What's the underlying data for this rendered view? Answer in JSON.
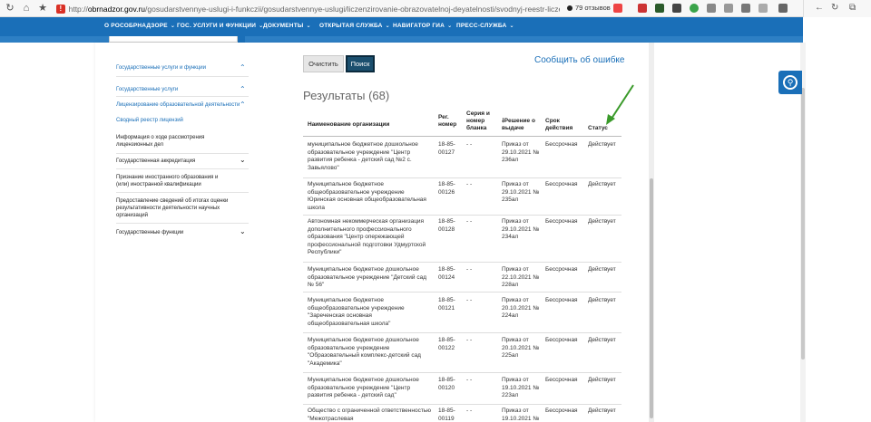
{
  "browser": {
    "url_host": "obrnadzor.gov.ru",
    "url_prefix": "http://",
    "url_path": "/gosudarstvennye-uslugi-i-funkczii/gosudarstvennye-uslugi/liczenzirovanie-obrazovatelnoj-deyatelnosti/svodnyj-reestr-liczenzij/",
    "reviews": "79 отзывов"
  },
  "topnav": {
    "items": [
      "О РОСОБРНАДЗОРЕ",
      "ГОС. УСЛУГИ И ФУНКЦИИ",
      "ДОКУМЕНТЫ",
      "ОТКРЫТАЯ СЛУЖБА",
      "НАВИГАТОР ГИА",
      "ПРЕСС-СЛУЖБА"
    ]
  },
  "sidebar": {
    "items": [
      "Государственные услуги и функции",
      "Государственные услуги",
      "Лицензирование образовательной деятельности",
      "Сводный реестр лицензий",
      "Информация о ходе рассмотрения лицензионных дел",
      "Государственная аккредитация",
      "Признание иностранного образования и (или) иностранной квалификации",
      "Предоставление сведений об итогах оценки результативности деятельности научных организаций",
      "Государственные функции"
    ]
  },
  "form": {
    "clear_label": "Очистить",
    "search_label": "Поиск",
    "report_label": "Сообщить об ошибке"
  },
  "results": {
    "title": "Результаты (68)",
    "headers": {
      "name": "Наименование организации",
      "reg": "Рег. номер",
      "series": "Серия и номер бланка",
      "decision": "Решение о выдаче",
      "term": "Срок действия",
      "status": "Статус"
    },
    "rows": [
      {
        "name": "муниципальное бюджетное дошкольное образовательное учреждение \"Центр развития ребенка - детский сад №2 с. Завьялово\"",
        "reg": "18-85-00127",
        "series": "- -",
        "decision": "Приказ от 29.10.2021 № 236ал",
        "term": "Бессрочная",
        "status": "Действует"
      },
      {
        "name": "Муниципальное бюджетное общеобразовательное учреждение Юринская основная общеобразовательная школа",
        "reg": "18-85-00126",
        "series": "- -",
        "decision": "Приказ от 29.10.2021 № 235ал",
        "term": "Бессрочная",
        "status": "Действует"
      },
      {
        "name": "Автономная некоммерческая организация дополнительного профессионального образования \"Центр опережающей профессиональной подготовки Удмуртской Республики\"",
        "reg": "18-85-00128",
        "series": "- -",
        "decision": "Приказ от 29.10.2021 № 234ал",
        "term": "Бессрочная",
        "status": "Действует"
      },
      {
        "name": "Муниципальное бюджетное дошкольное образовательное учреждение \"Детский сад № 56\"",
        "reg": "18-85-00124",
        "series": "- -",
        "decision": "Приказ от 22.10.2021 № 228ал",
        "term": "Бессрочная",
        "status": "Действует"
      },
      {
        "name": "Муниципальное бюджетное общеобразовательное учреждение \"Зареченская основная общеобразовательная школа\"",
        "reg": "18-85-00121",
        "series": "- -",
        "decision": "Приказ от 20.10.2021 № 224ал",
        "term": "Бессрочная",
        "status": "Действует"
      },
      {
        "name": "Муниципальное бюджетное дошкольное образовательное учреждение \"Образовательный комплекс-детский сад \"Академика\"",
        "reg": "18-85-00122",
        "series": "- -",
        "decision": "Приказ от 20.10.2021 № 225ал",
        "term": "Бессрочная",
        "status": "Действует"
      },
      {
        "name": "Муниципальное бюджетное дошкольное образовательное учреждение \"Центр развития ребенка - детский сад\"",
        "reg": "18-85-00120",
        "series": "- -",
        "decision": "Приказ от 19.10.2021 № 223ал",
        "term": "Бессрочная",
        "status": "Действует"
      },
      {
        "name": "Общество с ограниченной ответственностью \"Межотраслевая",
        "reg": "18-85-00119",
        "series": "- -",
        "decision": "Приказ от 19.10.2021 №",
        "term": "Бессрочная",
        "status": "Действует"
      }
    ]
  },
  "colors": {
    "brand_blue": "#1a6fb8",
    "annotation_green": "#3a9a2a"
  }
}
